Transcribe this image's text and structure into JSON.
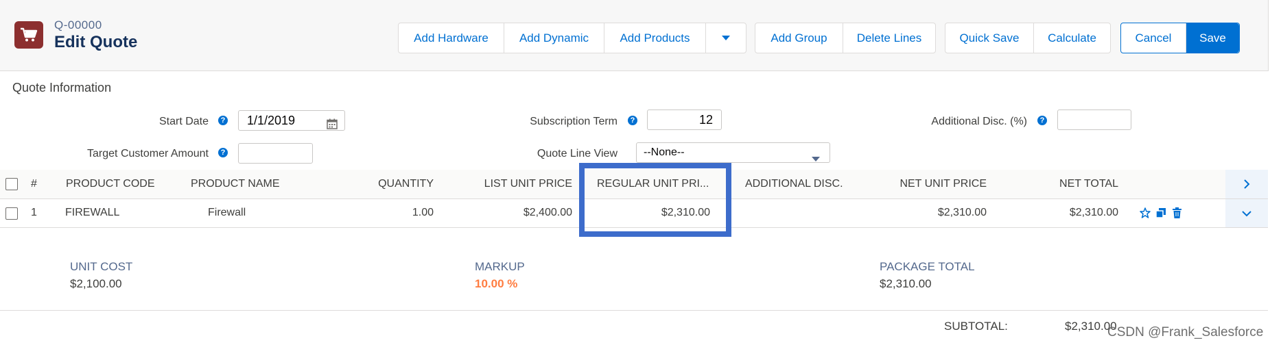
{
  "header": {
    "quote_number": "Q-00000",
    "title": "Edit Quote",
    "app_icon": "shopping-cart-icon",
    "buttons": {
      "add_hardware": "Add Hardware",
      "add_dynamic": "Add Dynamic",
      "add_products": "Add Products",
      "add_group": "Add Group",
      "delete_lines": "Delete Lines",
      "quick_save": "Quick Save",
      "calculate": "Calculate",
      "cancel": "Cancel",
      "save": "Save"
    }
  },
  "quote_info": {
    "title": "Quote Information",
    "start_date_label": "Start Date",
    "start_date_value": "1/1/2019",
    "subscription_term_label": "Subscription Term",
    "subscription_term_value": "12",
    "additional_disc_label": "Additional Disc. (%)",
    "additional_disc_value": "",
    "target_amount_label": "Target Customer Amount",
    "target_amount_value": "",
    "line_view_label": "Quote Line View",
    "line_view_value": "--None--"
  },
  "table": {
    "headers": {
      "index": "#",
      "product_code": "PRODUCT CODE",
      "product_name": "PRODUCT NAME",
      "quantity": "QUANTITY",
      "list_unit_price": "LIST UNIT PRICE",
      "regular_unit_price": "REGULAR UNIT PRI...",
      "additional_disc": "ADDITIONAL DISC.",
      "net_unit_price": "NET UNIT PRICE",
      "net_total": "NET TOTAL"
    },
    "rows": [
      {
        "index": "1",
        "product_code": "FIREWALL",
        "product_name": "Firewall",
        "quantity": "1.00",
        "list_unit_price": "$2,400.00",
        "regular_unit_price": "$2,310.00",
        "additional_disc": "",
        "net_unit_price": "$2,310.00",
        "net_total": "$2,310.00"
      }
    ]
  },
  "detail": {
    "unit_cost_label": "UNIT COST",
    "unit_cost_value": "$2,100.00",
    "markup_label": "MARKUP",
    "markup_value": "10.00 %",
    "package_total_label": "PACKAGE TOTAL",
    "package_total_value": "$2,310.00"
  },
  "footer": {
    "subtotal_label": "SUBTOTAL:",
    "subtotal_value": "$2,310.00"
  },
  "watermark": "CSDN @Frank_Salesforce",
  "colors": {
    "accent": "#0070d2",
    "app_icon": "#8c2f2f",
    "highlight": "#3d6ccb",
    "markup": "#ff7d41"
  }
}
